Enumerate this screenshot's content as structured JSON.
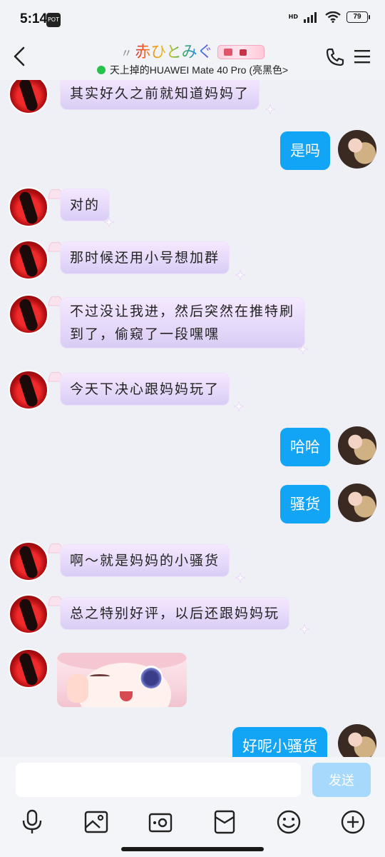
{
  "status_bar": {
    "time": "5:14",
    "badge": "POT",
    "network": "HD",
    "battery": "79"
  },
  "header": {
    "title_prefix": "〃",
    "title": "赤ひとみぐ",
    "subtitle": "天上掉的HUAWEI Mate 40 Pro (亮黑色>"
  },
  "messages": [
    {
      "side": "left",
      "text": "其实好久之前就知道妈妈了"
    },
    {
      "side": "right",
      "text": "是吗"
    },
    {
      "side": "left",
      "text": "对的"
    },
    {
      "side": "left",
      "text": "那时候还用小号想加群"
    },
    {
      "side": "left",
      "text": "不过没让我进，然后突然在推特刷到了，偷窥了一段嘿嘿"
    },
    {
      "side": "left",
      "text": "今天下决心跟妈妈玩了"
    },
    {
      "side": "right",
      "text": "哈哈"
    },
    {
      "side": "right",
      "text": "骚货"
    },
    {
      "side": "left",
      "text": "啊～就是妈妈的小骚货"
    },
    {
      "side": "left",
      "text": "总之特别好评，以后还跟妈妈玩"
    },
    {
      "side": "left",
      "type": "sticker",
      "text": ""
    },
    {
      "side": "right",
      "text": "好呢小骚货"
    }
  ],
  "input": {
    "placeholder": "",
    "value": "",
    "send_label": "发送"
  },
  "toolbar": {
    "icons": [
      "microphone-icon",
      "image-icon",
      "camera-icon",
      "red-packet-icon",
      "emoji-icon",
      "plus-icon"
    ]
  },
  "colors": {
    "bubble_right": "#12a5f5",
    "send_disabled": "#a6d9fb",
    "online": "#27c24c"
  }
}
